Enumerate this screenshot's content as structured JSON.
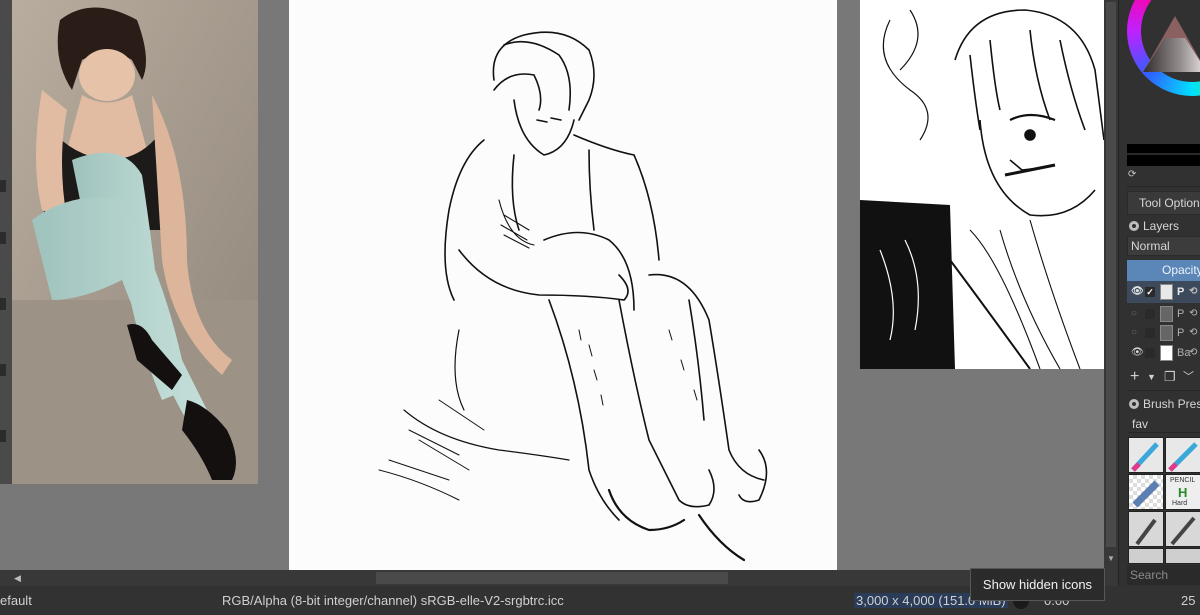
{
  "docker": {
    "tool_options_label": "Tool Options",
    "layers_title": "Layers",
    "blend_mode": "Normal",
    "opacity_label": "Opacity",
    "layers": [
      {
        "name": "P",
        "visible": true,
        "active": true
      },
      {
        "name": "P",
        "visible": false,
        "active": false
      },
      {
        "name": "P",
        "visible": false,
        "active": false
      },
      {
        "name": "Ba",
        "visible": true,
        "active": false
      }
    ],
    "brush_presets_title": "Brush Prese",
    "brush_filter": "fav",
    "brush_hard_label_line1": "PENCIL",
    "brush_hard_label_line2": "H",
    "brush_hard_label_line3": "Hard",
    "search_placeholder": "Search"
  },
  "statusbar": {
    "preset_name": "efault",
    "color_space": "RGB/Alpha (8-bit integer/channel)  sRGB-elle-V2-srgbtrc.icc",
    "image_size": "3,000 x 4,000 (151.0 MiB)",
    "rotation": "0.00",
    "zoom": "25"
  },
  "tooltip": {
    "text": "Show hidden icons"
  },
  "colors": {
    "accent": "#5a86b8",
    "canvas_bg": "#787878",
    "docker_bg": "#313131",
    "statusbar_bg": "#323232"
  }
}
